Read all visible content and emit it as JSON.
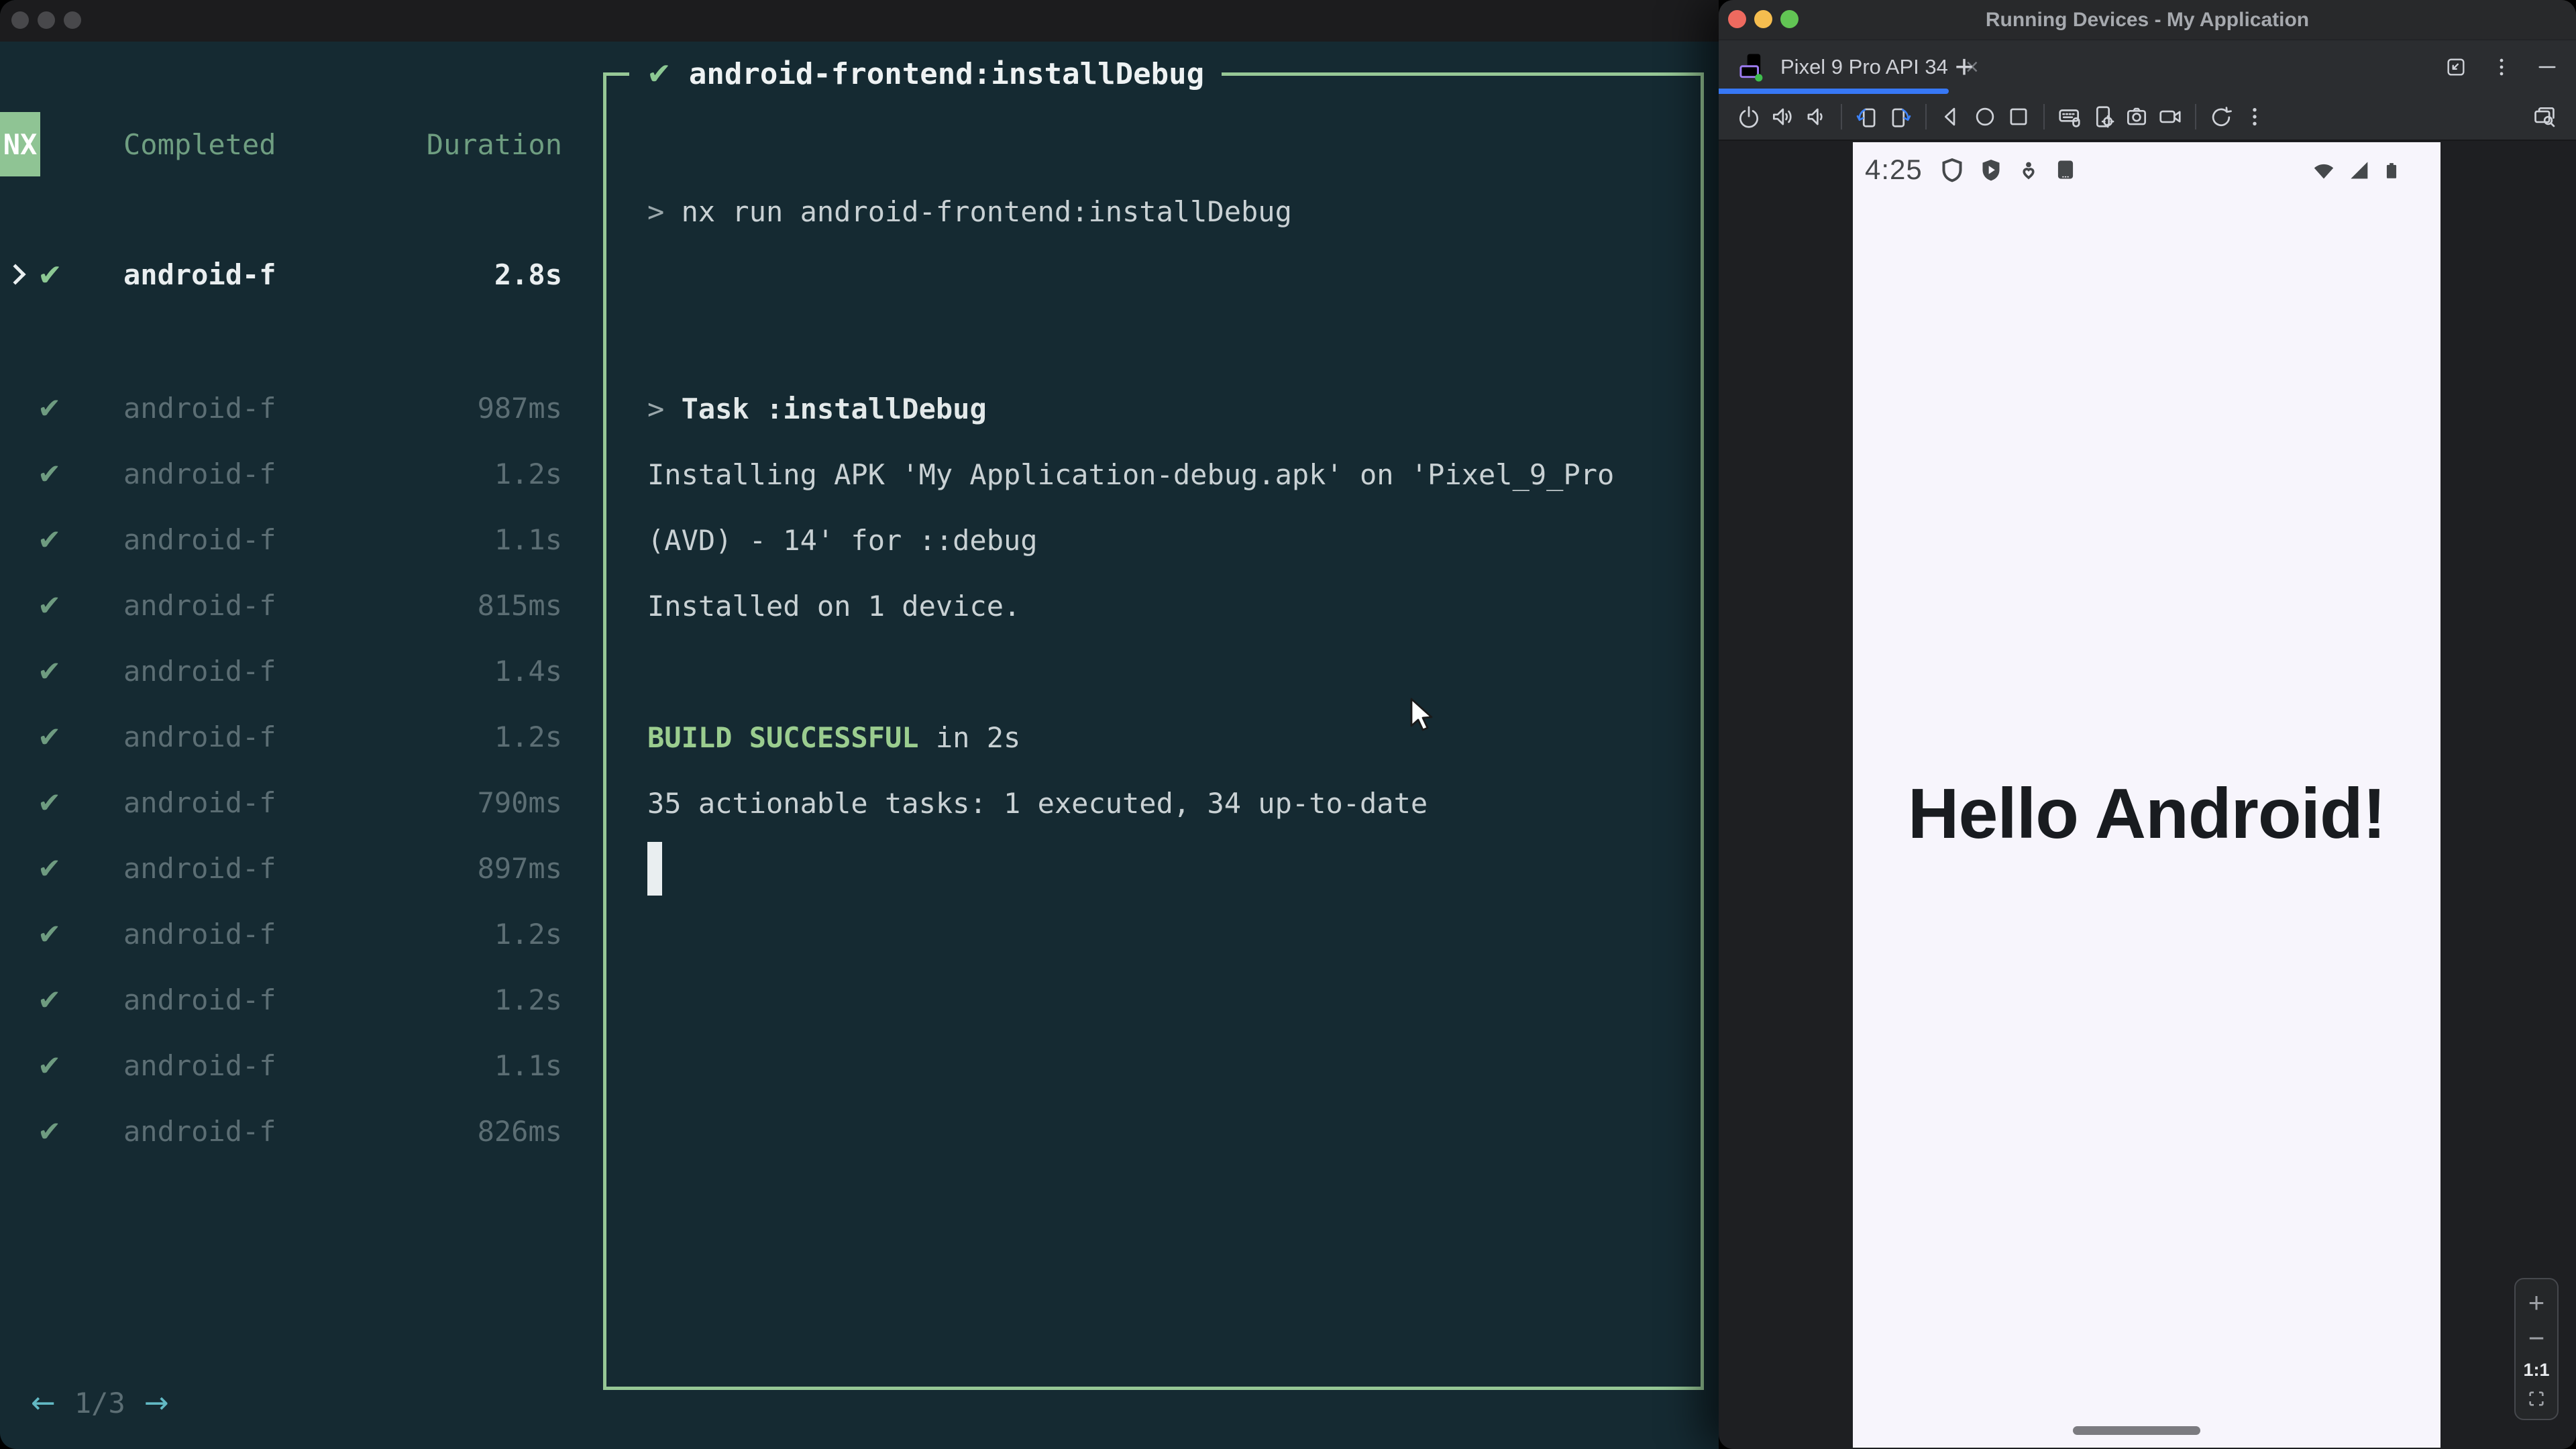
{
  "glyphs": {
    "check": "✔",
    "arrow_left": "←",
    "arrow_right": "→",
    "close": "×",
    "plus": "+"
  },
  "colors": {
    "terminal_bg": "#152a32",
    "nx_green": "#8fc494",
    "border_green": "#96c795",
    "build_green": "#9bcd8f",
    "header_green": "#6f9e81",
    "dim_text": "#5c6e74",
    "teal_arrow": "#62b9c4",
    "tab_blue": "#3778f6",
    "screen_bg": "#f7f5fc"
  },
  "left_window": {
    "tasks_panel": {
      "logo_label": "NX",
      "completed_header": "Completed",
      "duration_header": "Duration",
      "selected_task": {
        "name": "android-f",
        "duration": "2.8s"
      },
      "tasks": [
        {
          "name": "android-f",
          "duration": "987ms"
        },
        {
          "name": "android-f",
          "duration": "1.2s"
        },
        {
          "name": "android-f",
          "duration": "1.1s"
        },
        {
          "name": "android-f",
          "duration": "815ms"
        },
        {
          "name": "android-f",
          "duration": "1.4s"
        },
        {
          "name": "android-f",
          "duration": "1.2s"
        },
        {
          "name": "android-f",
          "duration": "790ms"
        },
        {
          "name": "android-f",
          "duration": "897ms"
        },
        {
          "name": "android-f",
          "duration": "1.2s"
        },
        {
          "name": "android-f",
          "duration": "1.2s"
        },
        {
          "name": "android-f",
          "duration": "1.1s"
        },
        {
          "name": "android-f",
          "duration": "826ms"
        }
      ],
      "pagination": {
        "current": "1/3"
      }
    },
    "output_panel": {
      "title": "android-frontend:installDebug",
      "lines": [
        {
          "segments": [
            {
              "t": "> ",
              "c": "prompt"
            },
            {
              "t": "nx run android-frontend:installDebug",
              "c": "normal"
            }
          ]
        },
        {
          "segments": []
        },
        {
          "segments": []
        },
        {
          "segments": [
            {
              "t": "> ",
              "c": "prompt"
            },
            {
              "t": "Task :installDebug",
              "c": "bold"
            }
          ]
        },
        {
          "segments": [
            {
              "t": "Installing APK 'My Application-debug.apk' on 'Pixel_9_Pro",
              "c": "normal"
            }
          ]
        },
        {
          "segments": [
            {
              "t": "(AVD) - 14' for ::debug",
              "c": "normal"
            }
          ]
        },
        {
          "segments": [
            {
              "t": "Installed on 1 device.",
              "c": "normal"
            }
          ]
        },
        {
          "segments": []
        },
        {
          "segments": [
            {
              "t": "BUILD SUCCESSFUL",
              "c": "green-bold"
            },
            {
              "t": " in 2s",
              "c": "normal"
            }
          ]
        },
        {
          "segments": [
            {
              "t": "35 actionable tasks: 1 executed, 34 up-to-date",
              "c": "normal"
            }
          ]
        },
        {
          "cursor": true,
          "segments": []
        }
      ]
    }
  },
  "right_window": {
    "title": "Running Devices - My Application",
    "tab": {
      "label": "Pixel 9 Pro API 34"
    },
    "toolbar": {
      "icons": [
        "power",
        "volume-up",
        "volume-down",
        "rotate-left",
        "rotate-right",
        "back",
        "home",
        "overview",
        "hardware-input",
        "device-settings",
        "screenshot",
        "screen-record",
        "restart",
        "more",
        "device-mirror"
      ]
    },
    "emulator": {
      "time": "4:25",
      "status_icons_left": [
        "shield-outline",
        "play-protect",
        "wellbeing",
        "letter-a-app"
      ],
      "status_icons_right": [
        "wifi",
        "cellular-signal",
        "battery"
      ],
      "hello_text": "Hello Android!"
    },
    "zoom_controls": {
      "zoom_in": "+",
      "zoom_out": "−",
      "actual_size": "1:1"
    }
  }
}
